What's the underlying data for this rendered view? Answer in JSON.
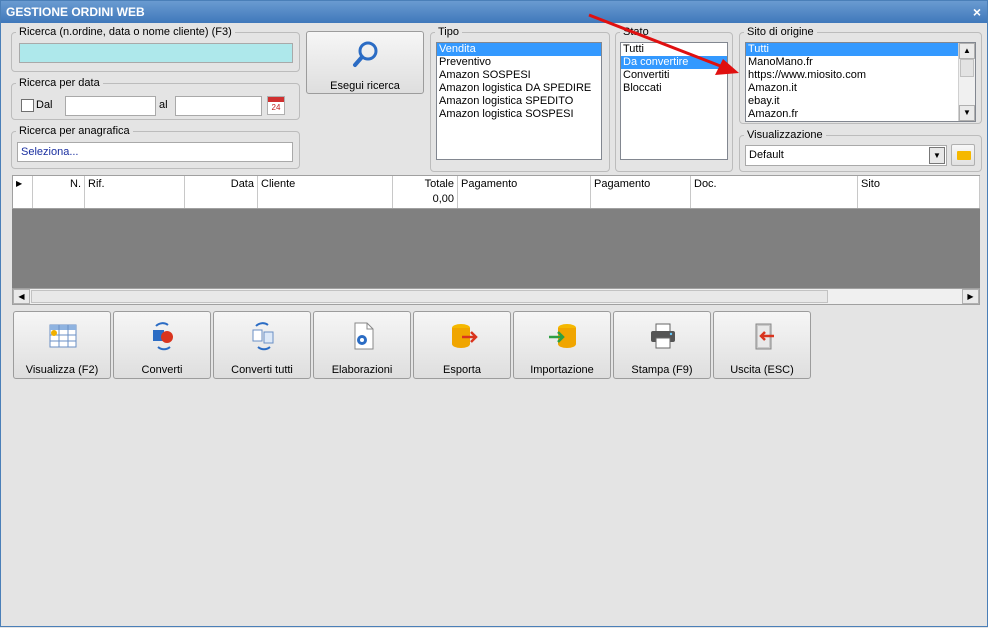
{
  "window": {
    "title": "GESTIONE ORDINI WEB",
    "close_glyph": "×"
  },
  "search": {
    "label": "Ricerca (n.ordine, data o nome cliente) (F3)",
    "value": ""
  },
  "date_search": {
    "label": "Ricerca per data",
    "from_label": "Dal",
    "to_label": "al",
    "from_value": "",
    "to_value": "",
    "calendar_day": "24"
  },
  "registry_search": {
    "label": "Ricerca per anagrafica",
    "value": "Seleziona..."
  },
  "search_button": {
    "label": "Esegui ricerca"
  },
  "tipo": {
    "label": "Tipo",
    "items": [
      "Vendita",
      "Preventivo",
      "Amazon SOSPESI",
      "Amazon logistica DA SPEDIRE",
      "Amazon logistica SPEDITO",
      "Amazon logistica SOSPESI"
    ],
    "selected": 0
  },
  "stato": {
    "label": "Stato",
    "items": [
      "Tutti",
      "Da convertire",
      "Convertiti",
      "Bloccati"
    ],
    "selected": 1
  },
  "sito": {
    "label": "Sito di origine",
    "items": [
      "Tutti",
      "ManoMano.fr",
      "https://www.miosito.com",
      "Amazon.it",
      "ebay.it",
      "Amazon.fr"
    ],
    "selected": 0
  },
  "visualizzazione": {
    "label": "Visualizzazione",
    "value": "Default"
  },
  "grid": {
    "columns": [
      "N.",
      "Rif.",
      "Data",
      "Cliente",
      "Totale",
      "Pagamento",
      "Pagamento",
      "Doc.",
      "Sito"
    ],
    "row": [
      "",
      "",
      "",
      "",
      "0,00",
      "",
      "",
      "",
      ""
    ]
  },
  "toolbar": [
    {
      "label": "Visualizza (F2)",
      "icon": "grid-view-icon"
    },
    {
      "label": "Converti",
      "icon": "convert-icon"
    },
    {
      "label": "Converti tutti",
      "icon": "convert-all-icon"
    },
    {
      "label": "Elaborazioni",
      "icon": "document-gear-icon"
    },
    {
      "label": "Esporta",
      "icon": "database-export-icon"
    },
    {
      "label": "Importazione",
      "icon": "database-import-icon"
    },
    {
      "label": "Stampa (F9)",
      "icon": "printer-icon"
    },
    {
      "label": "Uscita (ESC)",
      "icon": "exit-door-icon"
    }
  ],
  "colors": {
    "title_bar": "#3f78bb",
    "search_field": "#aee8eb",
    "selection": "#3399ff",
    "annotation_arrow": "#e01010",
    "grid_empty": "#808080"
  }
}
